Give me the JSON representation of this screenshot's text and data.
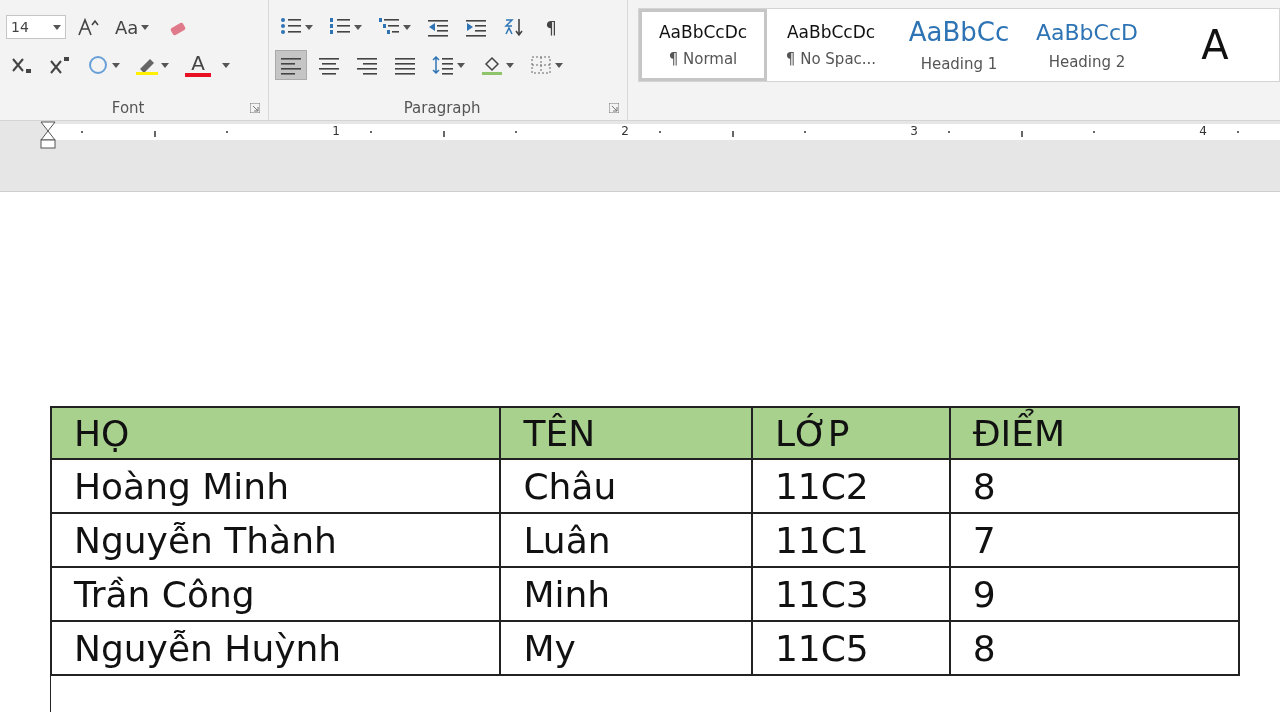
{
  "ribbon": {
    "font_group": {
      "label": "Font",
      "size": "14",
      "change_case": "Aa",
      "font_color": "A"
    },
    "paragraph_group": {
      "label": "Paragraph",
      "show_marks": "¶",
      "alignments": [
        {
          "kind": "left",
          "selected": true
        },
        {
          "kind": "center",
          "selected": false
        },
        {
          "kind": "right",
          "selected": false
        },
        {
          "kind": "justify",
          "selected": false
        }
      ]
    },
    "styles": [
      {
        "sample": "AaBbCcDc",
        "name": "¶ Normal",
        "kind": "body",
        "selected": true
      },
      {
        "sample": "AaBbCcDc",
        "name": "¶ No Spac...",
        "kind": "body",
        "selected": false
      },
      {
        "sample": "AaBbCc",
        "name": "Heading 1",
        "kind": "heading1",
        "selected": false
      },
      {
        "sample": "AaBbCcD",
        "name": "Heading 2",
        "kind": "heading2",
        "selected": false
      },
      {
        "sample": "A",
        "kind": "title",
        "selected": false
      }
    ]
  },
  "ruler": {
    "numbers": [
      "1",
      "2",
      "3",
      "4"
    ]
  },
  "table": {
    "columns": [
      "HỌ",
      "TÊN",
      "LỚP",
      "ĐIỂM"
    ],
    "rows": [
      [
        "Hoàng Minh",
        "Châu",
        "11C2",
        "8"
      ],
      [
        "Nguyễn Thành",
        "Luân",
        "11C1",
        "7"
      ],
      [
        "Trần Công",
        "Minh",
        "11C3",
        "9"
      ],
      [
        "Nguyễn Huỳnh",
        "My",
        "11C5",
        "8"
      ]
    ]
  }
}
